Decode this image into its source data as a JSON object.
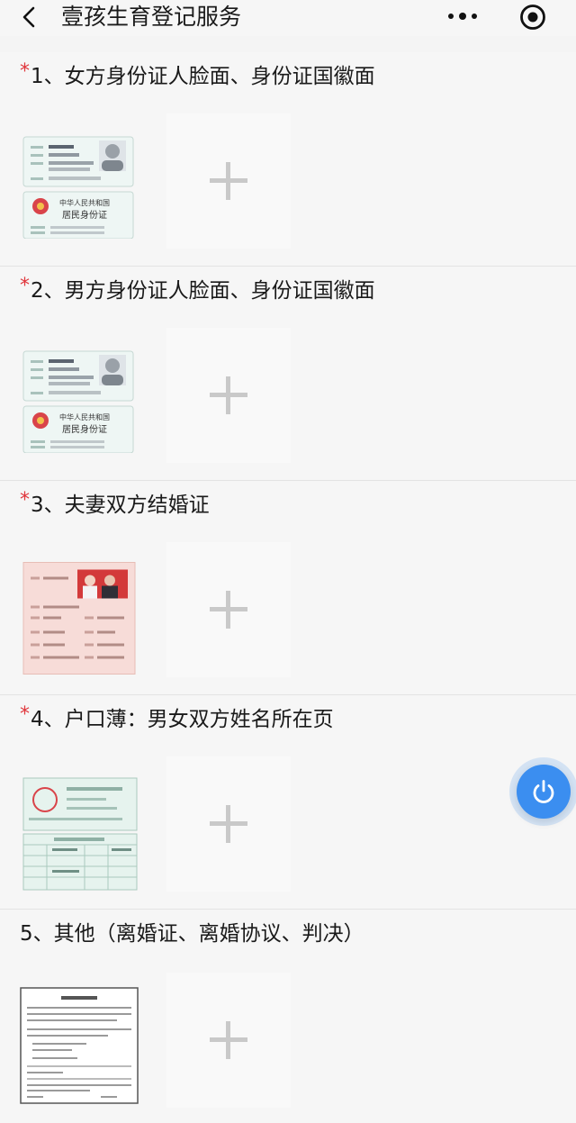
{
  "header": {
    "title": "壹孩生育登记服务",
    "back_icon": "chevron-left-icon",
    "more_icon": "more-dots-icon",
    "target_icon": "target-icon"
  },
  "sections": [
    {
      "required": true,
      "title": "1、女方身份证人脸面、身份证国徽面",
      "sample": "id-card",
      "sample_text": {
        "title1": "中华人民共和国",
        "title2": "居民身份证"
      }
    },
    {
      "required": true,
      "title": "2、男方身份证人脸面、身份证国徽面",
      "sample": "id-card",
      "sample_text": {
        "title1": "中华人民共和国",
        "title2": "居民身份证"
      }
    },
    {
      "required": true,
      "title": "3、夫妻双方结婚证",
      "sample": "marriage-certificate"
    },
    {
      "required": true,
      "title": "4、户口薄：男女双方姓名所在页",
      "sample": "household-register"
    },
    {
      "required": false,
      "title": "5、其他（离婚证、离婚协议、判决）",
      "sample": "divorce-document"
    }
  ],
  "upload_icon": "plus-icon",
  "float_button_icon": "power-icon",
  "colors": {
    "required_star": "#e0353b",
    "fab": "#3b8ef0"
  }
}
